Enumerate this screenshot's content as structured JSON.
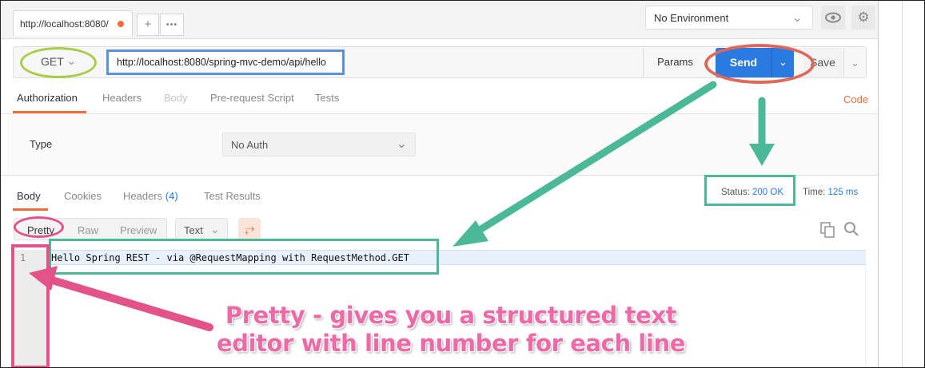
{
  "colors": {
    "accent": "#f26b3a",
    "send_blue": "#2a7ae2",
    "link_blue": "#2a7ae2",
    "annotation_green": "#a9cc46",
    "annotation_blue": "#5b8fe0",
    "annotation_red": "#e0685a",
    "annotation_teal": "#4bb897",
    "annotation_pink": "#e4528a"
  },
  "tabs": {
    "active_label": "http://localhost:8080/",
    "add_label": "+",
    "more_label": "•••"
  },
  "environment": {
    "selected": "No Environment",
    "eye_icon": "eye-icon",
    "settings_icon": "gear-icon"
  },
  "request": {
    "method": "GET",
    "url": "http://localhost:8080/spring-mvc-demo/api/hello",
    "params_label": "Params",
    "send_label": "Send",
    "save_label": "Save"
  },
  "request_tabs": [
    "Authorization",
    "Headers",
    "Body",
    "Pre-request Script",
    "Tests"
  ],
  "code_link": "Code",
  "auth": {
    "type_label": "Type",
    "type_value": "No Auth"
  },
  "response_tabs": {
    "body": "Body",
    "cookies": "Cookies",
    "headers": "Headers",
    "headers_count": "(4)",
    "tests": "Test Results"
  },
  "status": {
    "label": "Status:",
    "value": "200 OK",
    "time_label": "Time:",
    "time_value": "125 ms"
  },
  "view": {
    "pretty": "Pretty",
    "raw": "Raw",
    "preview": "Preview",
    "format": "Text"
  },
  "editor": {
    "line_number": "1",
    "line_text": "Hello Spring REST - via @RequestMapping with RequestMethod.GET"
  },
  "annotation": {
    "caption_line1": "Pretty - gives you a structured text",
    "caption_line2": "editor with line number for each line"
  }
}
